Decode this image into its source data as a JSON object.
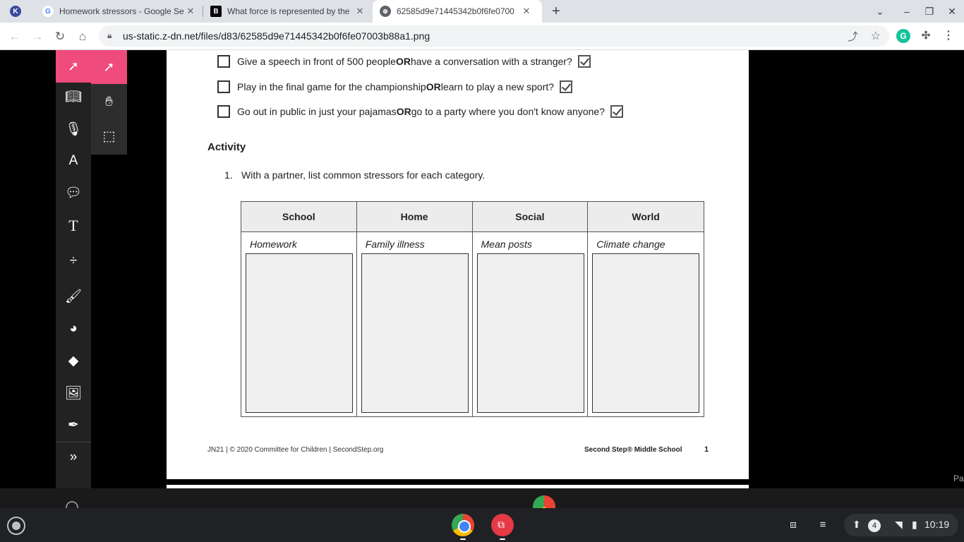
{
  "tabs": [
    {
      "favicon": "K",
      "title": ""
    },
    {
      "favicon": "G",
      "title": "Homework stressors - Google Se"
    },
    {
      "favicon": "B",
      "title": "What force is represented by the"
    },
    {
      "favicon": "globe",
      "title": "62585d9e71445342b0f6fe0700"
    }
  ],
  "address": {
    "url": "us-static.z-dn.net/files/d83/62585d9e71445342b0f6fe07003b88a1.png"
  },
  "questions": [
    {
      "before": "Give a speech in front of 500 people ",
      "or": "OR",
      "after": " have a conversation with a stranger?"
    },
    {
      "before": "Play in the final game for the championship ",
      "or": "OR",
      "after": " learn to play a new sport?"
    },
    {
      "before": "Go out in public in just your pajamas ",
      "or": "OR",
      "after": " go to a party where you don't know anyone?"
    }
  ],
  "activity": {
    "title": "Activity",
    "number": "1.",
    "instruction": "With a partner, list common stressors for each category."
  },
  "table": {
    "columns": [
      {
        "header": "School",
        "example": "Homework"
      },
      {
        "header": "Home",
        "example": "Family illness"
      },
      {
        "header": "Social",
        "example": "Mean posts"
      },
      {
        "header": "World",
        "example": "Climate change"
      }
    ]
  },
  "footer": {
    "left": "JN21 | © 2020 Committee for Children | SecondStep.org",
    "right": "Second Step® Middle School",
    "page": "1"
  },
  "side_text": "Pa",
  "shelf": {
    "notifications": "4",
    "time": "10:19"
  },
  "colors": {
    "kami_accent": "#ef4b7d",
    "tabbar": "#dee1e6"
  }
}
